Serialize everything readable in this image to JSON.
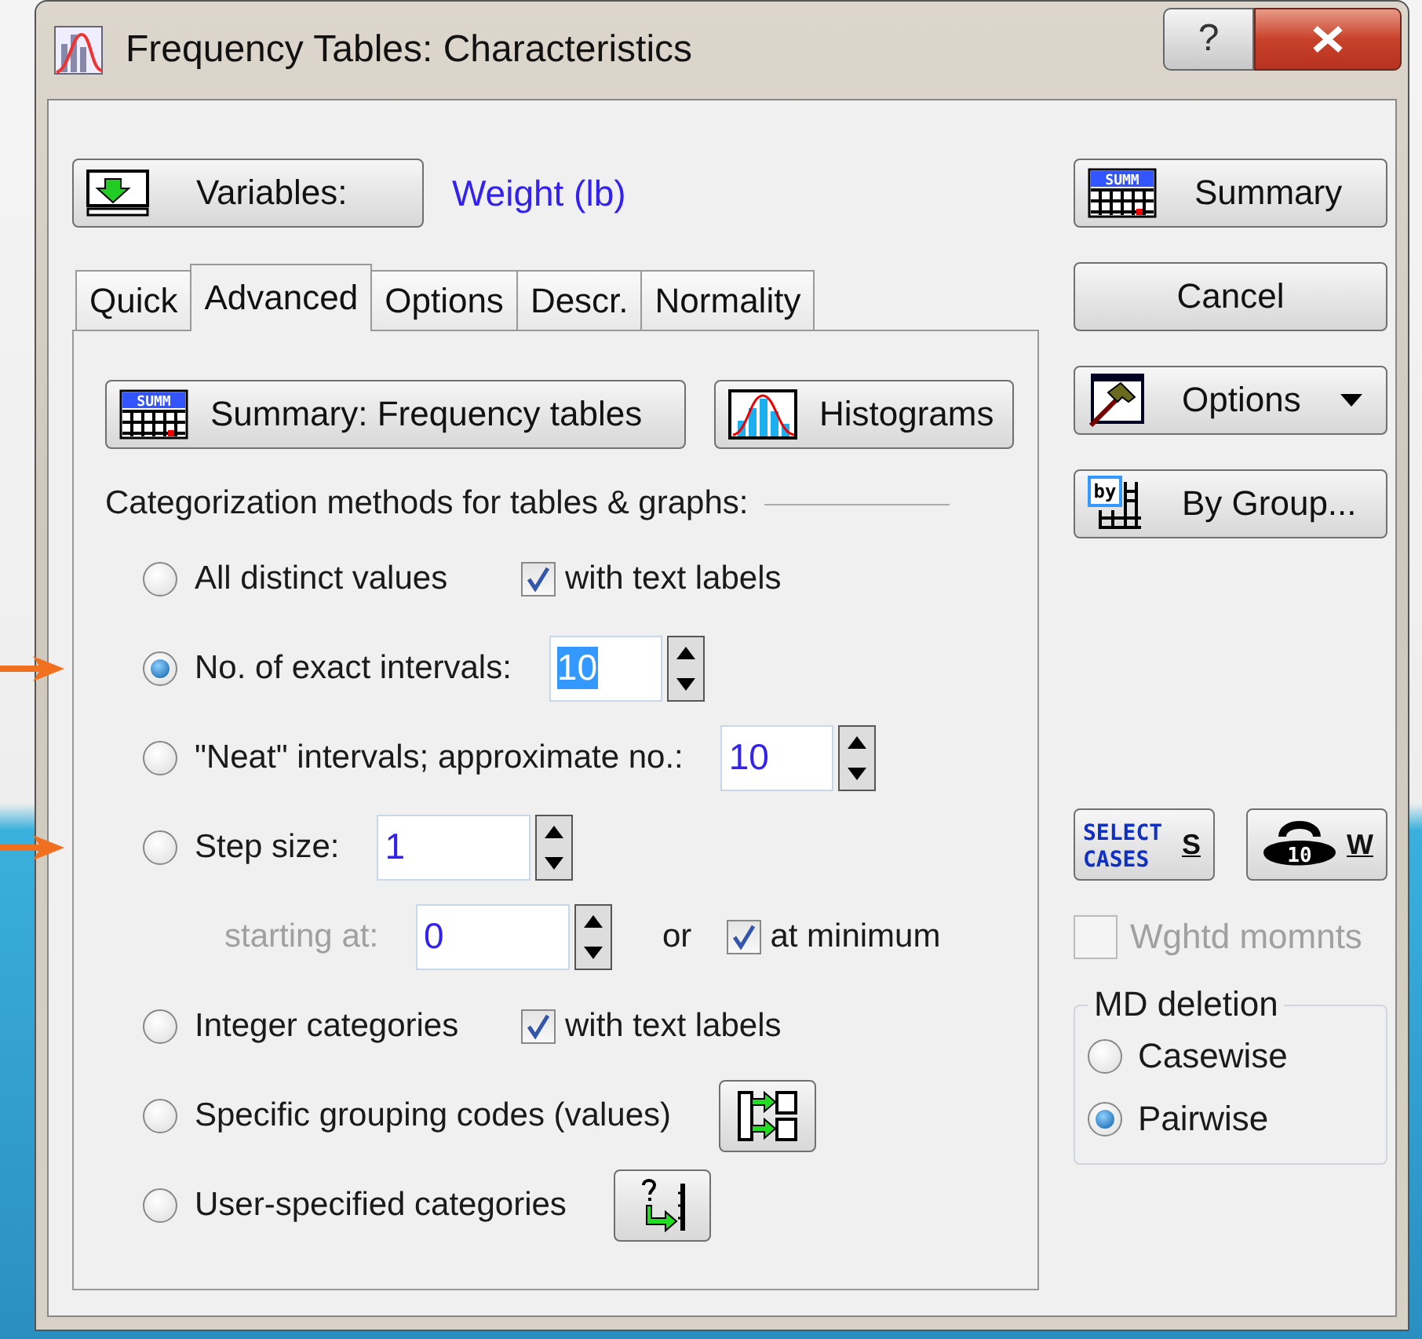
{
  "window": {
    "title": "Frequency Tables: Characteristics",
    "help_button": "?"
  },
  "variables": {
    "button": "Variables:",
    "value": "Weight (lb)"
  },
  "tabs": [
    {
      "label": "Quick",
      "selected": false
    },
    {
      "label": "Advanced",
      "selected": true
    },
    {
      "label": "Options",
      "selected": false
    },
    {
      "label": "Descr.",
      "selected": false
    },
    {
      "label": "Normality",
      "selected": false
    }
  ],
  "panel_buttons": [
    {
      "label": "Summary:  Frequency tables",
      "icon_text": "SUMM"
    },
    {
      "label": "Histograms"
    }
  ],
  "group_heading": "Categorization methods for tables & graphs:",
  "methods": [
    {
      "kind": "radio",
      "label": "All distinct values",
      "selected": false,
      "checkbox": {
        "label": "with text labels",
        "checked": true
      }
    },
    {
      "kind": "radio",
      "label": "No. of exact intervals:",
      "selected": true,
      "pointer": true,
      "spin": {
        "value": "10",
        "text_selected": true
      }
    },
    {
      "kind": "radio",
      "label": "\"Neat\" intervals; approximate no.:",
      "selected": false,
      "spin": {
        "value": "10",
        "text_selected": false
      }
    },
    {
      "kind": "radio",
      "label": "Step size:",
      "selected": false,
      "pointer": true,
      "spin": {
        "value": "1",
        "text_selected": false
      }
    },
    {
      "kind": "sub",
      "label": "starting at:",
      "disabled": true,
      "spin": {
        "value": "0",
        "text_selected": false
      },
      "joiner": "or",
      "checkbox": {
        "label": "at minimum",
        "checked": true
      }
    },
    {
      "kind": "radio",
      "label": "Integer categories",
      "selected": false,
      "checkbox": {
        "label": "with text labels",
        "checked": true
      }
    },
    {
      "kind": "radio",
      "label": "Specific grouping codes (values)",
      "selected": false,
      "tool_button": true
    },
    {
      "kind": "radio",
      "label": "User-specified categories",
      "selected": false,
      "tool_button": true
    }
  ],
  "side_buttons": [
    {
      "label": "Summary",
      "icon_text": "SUMM",
      "dropdown": false
    },
    {
      "label": "Cancel",
      "dropdown": false
    },
    {
      "label": "Options",
      "dropdown": true
    },
    {
      "label": "By Group...",
      "icon_text": "by",
      "dropdown": false
    }
  ],
  "select_cases": {
    "icon_lines": [
      "SELECT",
      "CASES"
    ],
    "label": "S"
  },
  "weights": {
    "icon_text": "10",
    "label": "W"
  },
  "weighted_moments": {
    "label": "Wghtd momnts",
    "checked": false,
    "disabled": true
  },
  "md_deletion": {
    "title": "MD deletion",
    "options": [
      {
        "label": "Casewise",
        "selected": false
      },
      {
        "label": "Pairwise",
        "selected": true
      }
    ]
  }
}
